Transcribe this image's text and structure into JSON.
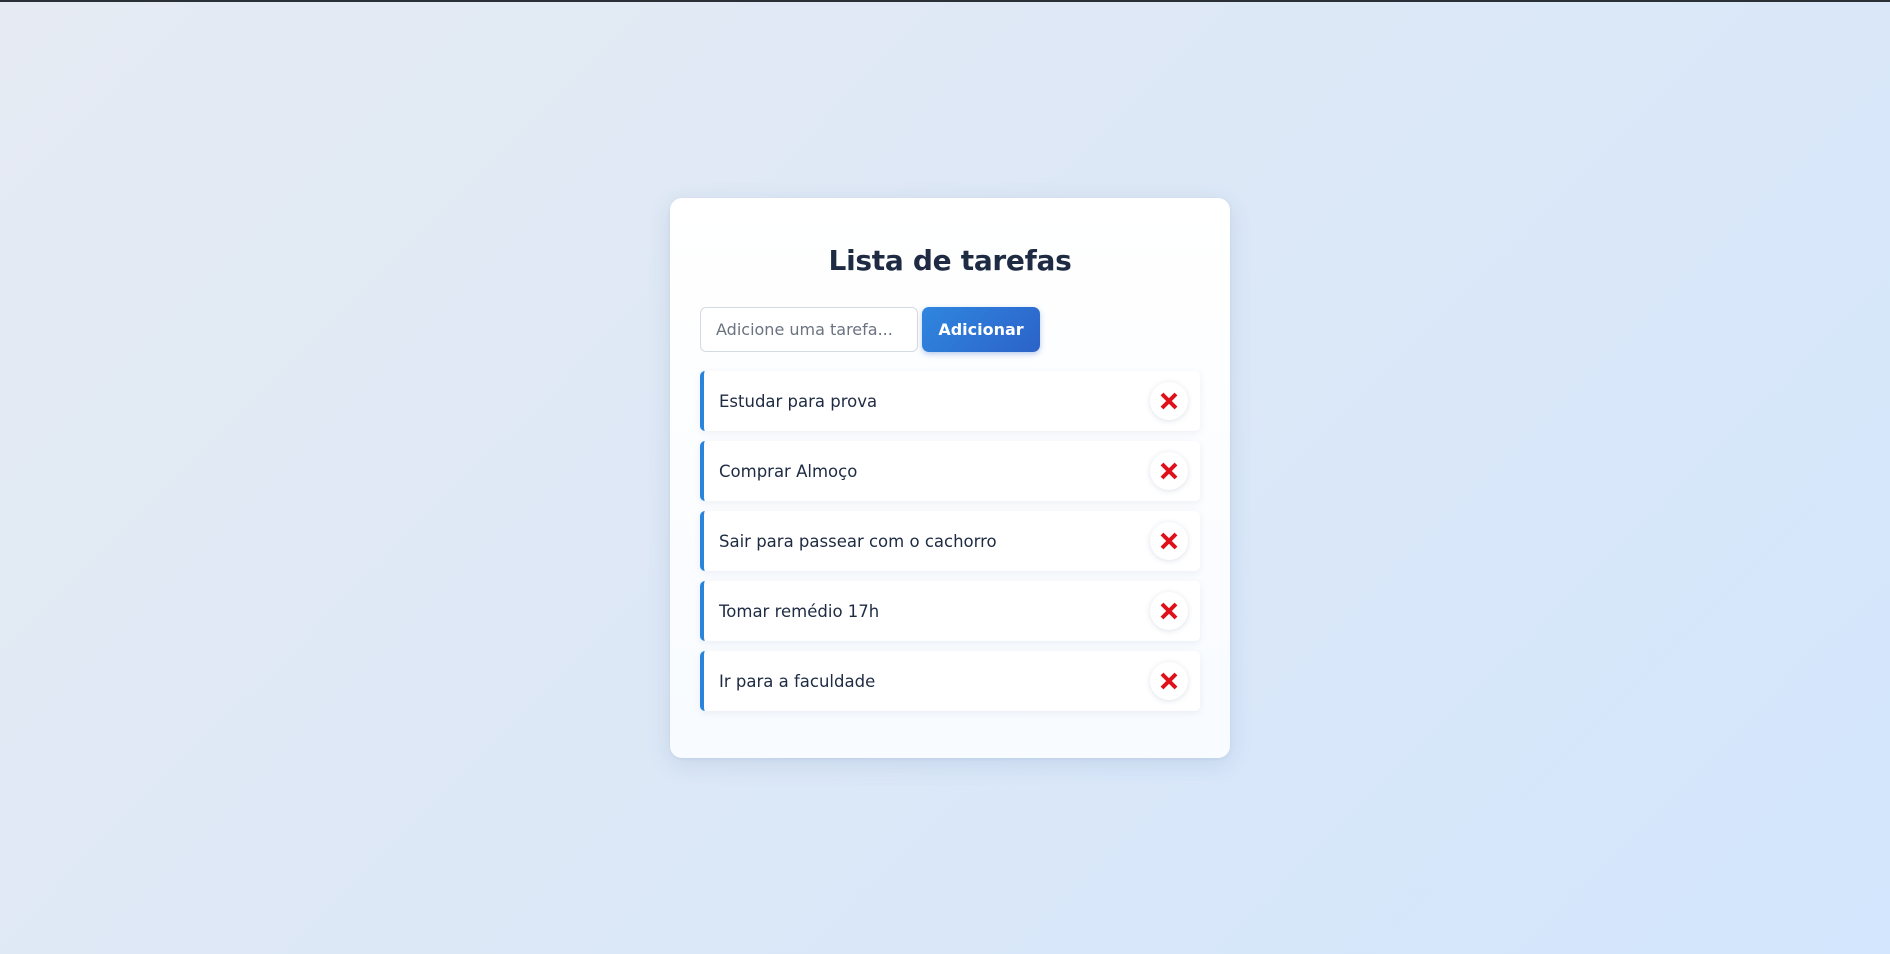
{
  "app": {
    "title": "Lista de tarefas"
  },
  "form": {
    "input_value": "",
    "input_placeholder": "Adicione uma tarefa...",
    "add_button_label": "Adicionar"
  },
  "tasks": [
    {
      "text": "Estudar para prova",
      "delete_icon": "close-icon"
    },
    {
      "text": "Comprar Almoço",
      "delete_icon": "close-icon"
    },
    {
      "text": "Sair para passear com o cachorro",
      "delete_icon": "close-icon"
    },
    {
      "text": "Tomar remédio 17h",
      "delete_icon": "close-icon"
    },
    {
      "text": "Ir para a faculdade",
      "delete_icon": "close-icon"
    }
  ],
  "colors": {
    "accent": "#2a84dc",
    "button_gradient_start": "#2f86df",
    "button_gradient_end": "#2c63c9",
    "delete_icon": "#e0101a",
    "title": "#1e2b43"
  }
}
